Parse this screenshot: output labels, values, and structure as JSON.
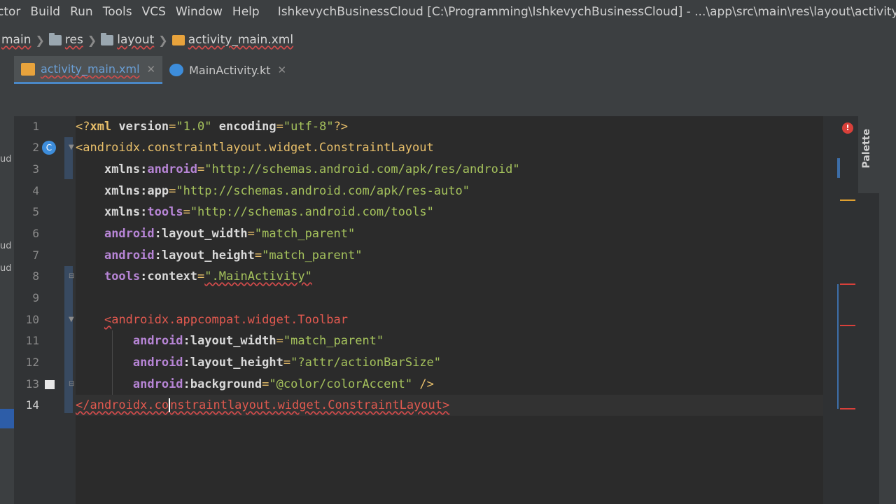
{
  "menubar": {
    "items": [
      "ctor",
      "Build",
      "Run",
      "Tools",
      "VCS",
      "Window",
      "Help"
    ],
    "title": "IshkevychBusinessCloud [C:\\Programming\\IshkevychBusinessCloud] - ...\\app\\src\\main\\res\\layout\\activity_main.xml [app] - A"
  },
  "breadcrumb": {
    "items": [
      "main",
      "res",
      "layout",
      "activity_main.xml"
    ]
  },
  "tabs": [
    {
      "label": "activity_main.xml",
      "icon": "xml-file-icon",
      "active": true
    },
    {
      "label": "MainActivity.kt",
      "icon": "kotlin-file-icon",
      "active": false
    }
  ],
  "leftstrip": {
    "labels": [
      "ud",
      "ud",
      "ud"
    ]
  },
  "editor": {
    "line_numbers": [
      "1",
      "2",
      "3",
      "4",
      "5",
      "6",
      "7",
      "8",
      "9",
      "10",
      "11",
      "12",
      "13",
      "14"
    ],
    "current_line": "14"
  },
  "code": {
    "l1": {
      "open": "<?",
      "tag": "xml",
      "a1": " version",
      "eq1": "=",
      "v1": "\"1.0\"",
      "a2": " encoding",
      "eq2": "=",
      "v2": "\"utf-8\"",
      "close": "?>"
    },
    "l2": {
      "tag": "<androidx.constraintlayout.widget.ConstraintLayout"
    },
    "l3": {
      "ns": "xmlns:",
      "name": "android",
      "eq": "=",
      "val": "\"http://schemas.android.com/apk/res/android\""
    },
    "l4": {
      "ns": "xmlns:",
      "name": "app",
      "eq": "=",
      "val": "\"http://schemas.android.com/apk/res-auto\""
    },
    "l5": {
      "ns": "xmlns:",
      "name": "tools",
      "eq": "=",
      "val": "\"http://schemas.android.com/tools\""
    },
    "l6": {
      "ns": "android",
      "name": ":layout_width",
      "eq": "=",
      "val": "\"match_parent\""
    },
    "l7": {
      "ns": "android",
      "name": ":layout_height",
      "eq": "=",
      "val": "\"match_parent\""
    },
    "l8": {
      "ns": "tools",
      "name": ":context",
      "eq": "=",
      "val": "\".MainActivity\""
    },
    "l10": {
      "lt": "<",
      "tag": "androidx.appcompat.widget.Toolbar"
    },
    "l11": {
      "ns": "android",
      "name": ":layout_width",
      "eq": "=",
      "val": "\"match_parent\""
    },
    "l12": {
      "ns": "android",
      "name": ":layout_height",
      "eq": "=",
      "val": "\"?attr/actionBarSize\""
    },
    "l13": {
      "ns": "android",
      "name": ":background",
      "eq": "=",
      "val": "\"@color/colorAccent\"",
      "close": " />"
    },
    "l14": {
      "before": "</androidx.co",
      "after": "nstraintlayout.widget.ConstraintLayout>"
    }
  },
  "palette": {
    "label": "Palette"
  },
  "colors": {
    "tag": "#e8bf6a",
    "attr_namespace": "#b785d6",
    "string_value": "#a5c25c",
    "error": "#e2594f",
    "accent": "#4a88c7"
  }
}
